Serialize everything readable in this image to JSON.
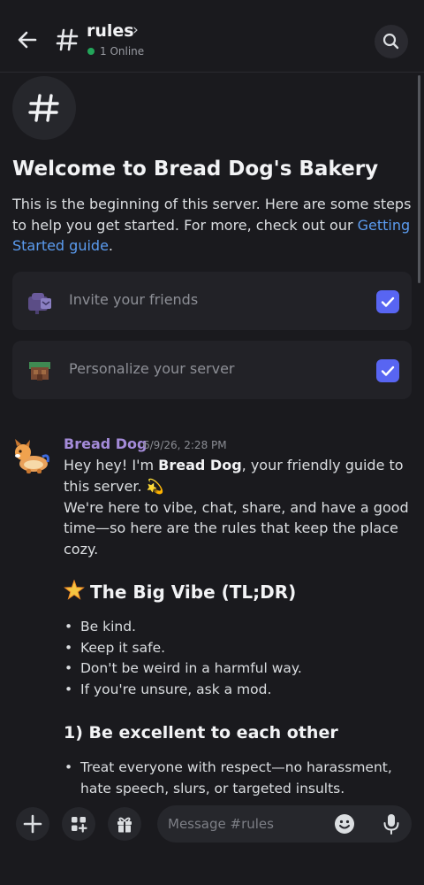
{
  "header": {
    "channel_name": "rules",
    "chevron": "›",
    "online_text": "1 Online",
    "back_icon": "arrow-left-icon",
    "search_icon": "search-icon"
  },
  "welcome": {
    "title": "Welcome to Bread Dog's Bakery",
    "desc_before": "This is the beginning of this server. Here are some steps to help you get started. For more, check out our ",
    "desc_link": "Getting Started guide",
    "desc_after": "."
  },
  "steps": [
    {
      "label": "Invite your friends",
      "checked": true
    },
    {
      "label": "Personalize your server",
      "checked": true
    }
  ],
  "message": {
    "author": "Bread Dog",
    "timestamp": "6/9/26, 2:28 PM",
    "line1_before": "Hey hey! I'm ",
    "line1_bold": "Bread Dog",
    "line1_after": ", your friendly guide to this server. 💫",
    "line2": "We're here to vibe, chat, share, and have a good time—so here are the rules that keep the place cozy.",
    "vibe_heading": "The Big Vibe (TL;DR)",
    "vibe_items": [
      "Be kind.",
      "Keep it safe.",
      "Don't be weird in a harmful way.",
      "If you're unsure, ask a mod."
    ],
    "section1_heading": "1) Be excellent to each other",
    "section1_items": [
      "Treat everyone with respect—no harassment, hate speech, slurs, or targeted insults."
    ]
  },
  "composer": {
    "placeholder": "Message #rules"
  },
  "colors": {
    "background": "#1a1a1e",
    "accent": "#5865f2",
    "link": "#5b9cf0",
    "author": "#a48bd9",
    "online": "#23a55a"
  }
}
